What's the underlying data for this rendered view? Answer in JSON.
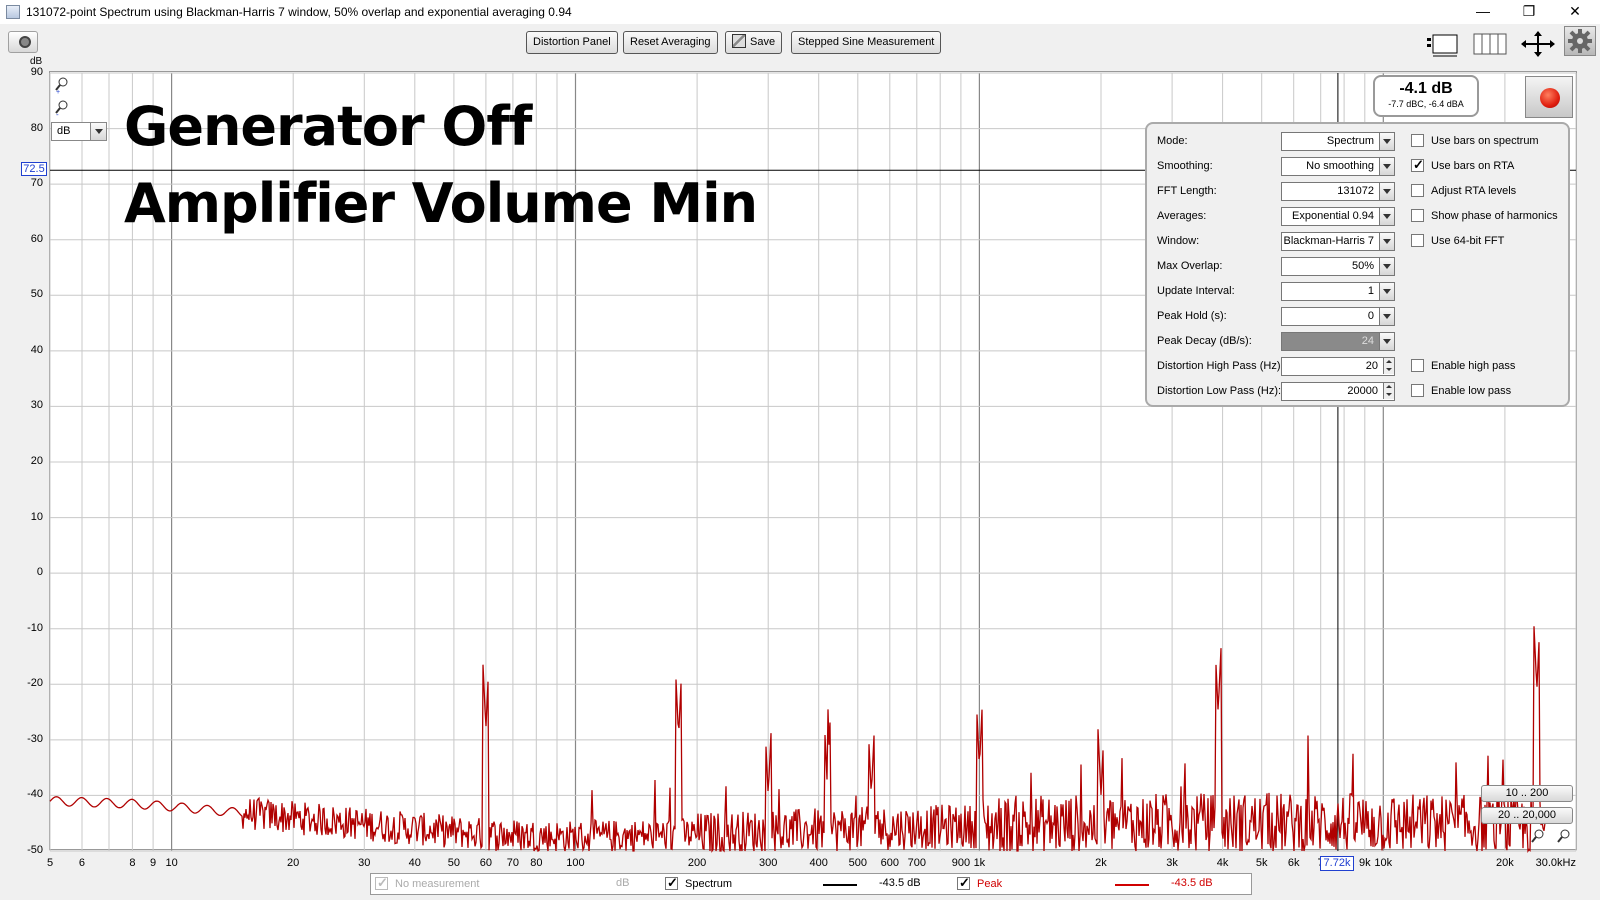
{
  "window": {
    "title": "131072-point Spectrum using Blackman-Harris 7 window, 50% overlap and exponential averaging 0.94",
    "min_glyph": "—",
    "max_glyph": "❐",
    "close_glyph": "✕"
  },
  "toolbar": {
    "distortion_panel": "Distortion Panel",
    "reset_averaging": "Reset Averaging",
    "save": "Save",
    "stepped_sine": "Stepped Sine Measurement",
    "icons": [
      "camera-icon",
      "save-icon",
      "graph-layout-icon",
      "column-layout-icon",
      "fit-axes-icon",
      "gear-icon"
    ]
  },
  "plot": {
    "y_unit": "dB",
    "unit_select": "dB",
    "y_ticks": [
      "90",
      "80",
      "70",
      "60",
      "50",
      "40",
      "30",
      "20",
      "10",
      "0",
      "-10",
      "-20",
      "-30",
      "-40",
      "-50"
    ],
    "x_ticks": [
      "5",
      "6",
      "7",
      "8",
      "9",
      "10",
      "20",
      "30",
      "40",
      "50",
      "60",
      "70",
      "80",
      "100",
      "200",
      "300",
      "400",
      "500",
      "600",
      "700",
      "900",
      "1k",
      "2k",
      "3k",
      "4k",
      "5k",
      "6k",
      "7",
      "9k",
      "10k",
      "20k",
      "30.0kHz"
    ],
    "cursor_y_value": "72.5",
    "cursor_x_value": "7.72k",
    "overlay_line1": "Generator Off",
    "overlay_line2": "Amplifier Volume Min",
    "trace_color": "#b00000"
  },
  "level": {
    "main": "-4.1 dB",
    "sub": "-7.7 dBC, -6.4 dBA"
  },
  "settings": {
    "mode_label": "Mode:",
    "mode_value": "Spectrum",
    "smoothing_label": "Smoothing:",
    "smoothing_value": "No  smoothing",
    "fft_label": "FFT Length:",
    "fft_value": "131072",
    "averages_label": "Averages:",
    "averages_value": "Exponential 0.94",
    "window_label": "Window:",
    "window_value": "Blackman-Harris 7",
    "overlap_label": "Max Overlap:",
    "overlap_value": "50%",
    "update_label": "Update Interval:",
    "update_value": "1",
    "peakhold_label": "Peak Hold (s):",
    "peakhold_value": "0",
    "peakdecay_label": "Peak Decay (dB/s):",
    "peakdecay_value": "24",
    "hp_label": "Distortion High Pass (Hz):",
    "hp_value": "20",
    "lp_label": "Distortion Low Pass (Hz):",
    "lp_value": "20000",
    "cb_bars_spectrum": "Use bars on spectrum",
    "cb_bars_rta": "Use bars on RTA",
    "cb_adjust_rta": "Adjust RTA levels",
    "cb_phase": "Show phase of harmonics",
    "cb_64bit": "Use 64-bit FFT",
    "cb_high_pass": "Enable high pass",
    "cb_low_pass": "Enable low pass"
  },
  "ranges": {
    "r1": "10 .. 200",
    "r2": "20 .. 20,000"
  },
  "legend": {
    "no_measurement": "No measurement",
    "no_measurement_unit": "dB",
    "spectrum": "Spectrum",
    "spectrum_value": "-43.5 dB",
    "peak": "Peak",
    "peak_value": "-43.5 dB",
    "peak_color": "#d00000"
  },
  "chart_data": {
    "type": "line",
    "title": "",
    "xlabel": "",
    "ylabel": "dB",
    "x_scale": "log",
    "xlim": [
      5,
      30000
    ],
    "ylim": [
      -50,
      90
    ],
    "grid": true,
    "series": [
      {
        "name": "Spectrum",
        "noise_floor_db": -45.5
      },
      {
        "name": "Peak"
      }
    ],
    "noise_floor": [
      [
        5,
        -41
      ],
      [
        8,
        -41.5
      ],
      [
        10,
        -42
      ],
      [
        20,
        -44
      ],
      [
        40,
        -46
      ],
      [
        60,
        -47
      ],
      [
        100,
        -47.5
      ],
      [
        200,
        -47
      ],
      [
        500,
        -46
      ],
      [
        1000,
        -45.5
      ],
      [
        3000,
        -45
      ],
      [
        10000,
        -45
      ],
      [
        20000,
        -45.5
      ],
      [
        30000,
        -46
      ]
    ],
    "peaks": [
      [
        60,
        -28
      ],
      [
        180,
        -29.5
      ],
      [
        300,
        -40
      ],
      [
        420,
        -38
      ],
      [
        540,
        -40
      ],
      [
        1000,
        -35
      ],
      [
        2000,
        -40
      ],
      [
        3900,
        -25
      ],
      [
        24000,
        -21
      ]
    ]
  }
}
